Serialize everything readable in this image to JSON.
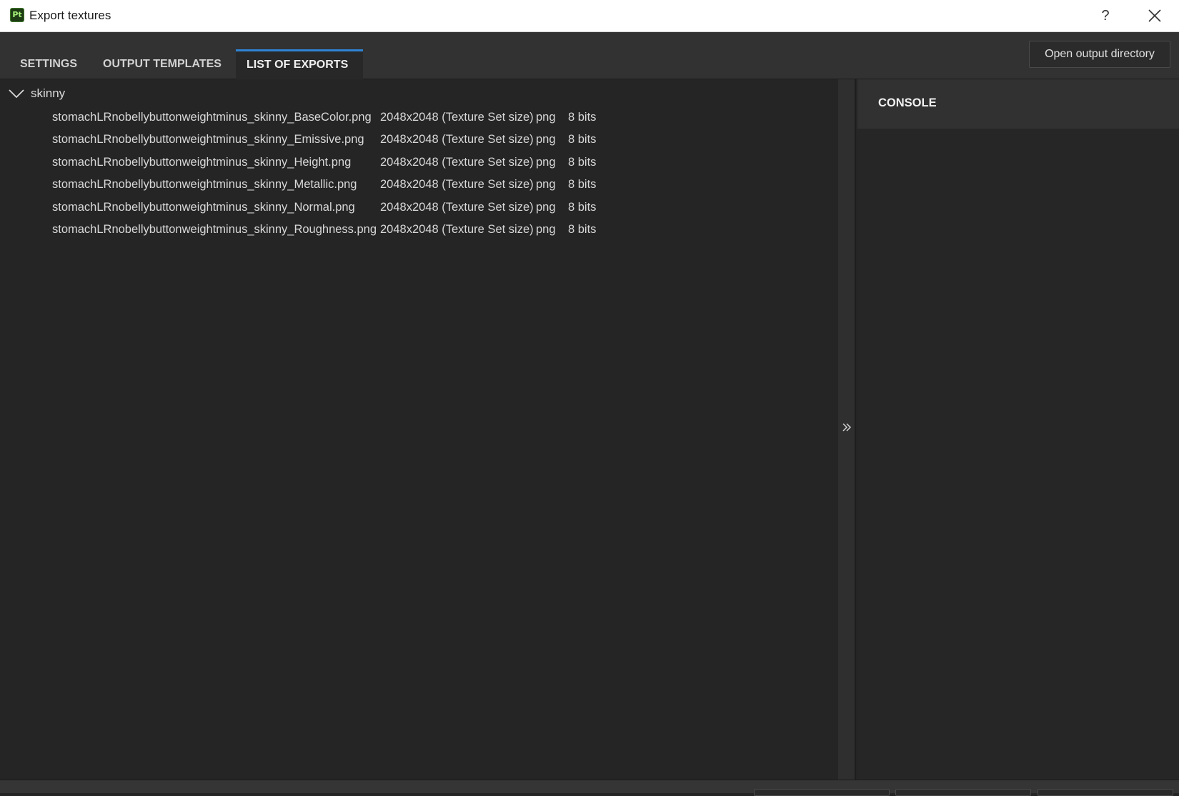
{
  "window": {
    "app_logo_text": "Pt",
    "title": "Export textures",
    "help_label": "?"
  },
  "tabs": [
    {
      "label": "SETTINGS",
      "active": false
    },
    {
      "label": "OUTPUT TEMPLATES",
      "active": false
    },
    {
      "label": "LIST OF EXPORTS",
      "active": true
    }
  ],
  "toolbar": {
    "open_output_directory_label": "Open output directory"
  },
  "export_list": {
    "group_name": "skinny",
    "items": [
      {
        "name": "stomachLRnobellybuttonweightminus_skinny_BaseColor.png",
        "size": "2048x2048 (Texture Set size)",
        "format": "png",
        "bits": "8 bits"
      },
      {
        "name": "stomachLRnobellybuttonweightminus_skinny_Emissive.png",
        "size": "2048x2048 (Texture Set size)",
        "format": "png",
        "bits": "8 bits"
      },
      {
        "name": "stomachLRnobellybuttonweightminus_skinny_Height.png",
        "size": "2048x2048 (Texture Set size)",
        "format": "png",
        "bits": "8 bits"
      },
      {
        "name": "stomachLRnobellybuttonweightminus_skinny_Metallic.png",
        "size": "2048x2048 (Texture Set size)",
        "format": "png",
        "bits": "8 bits"
      },
      {
        "name": "stomachLRnobellybuttonweightminus_skinny_Normal.png",
        "size": "2048x2048 (Texture Set size)",
        "format": "png",
        "bits": "8 bits"
      },
      {
        "name": "stomachLRnobellybuttonweightminus_skinny_Roughness.png",
        "size": "2048x2048 (Texture Set size)",
        "format": "png",
        "bits": "8 bits"
      }
    ]
  },
  "console": {
    "title": "CONSOLE"
  },
  "colors": {
    "accent": "#2f84d4",
    "background": "#252525",
    "titlebar": "#ffffff"
  }
}
